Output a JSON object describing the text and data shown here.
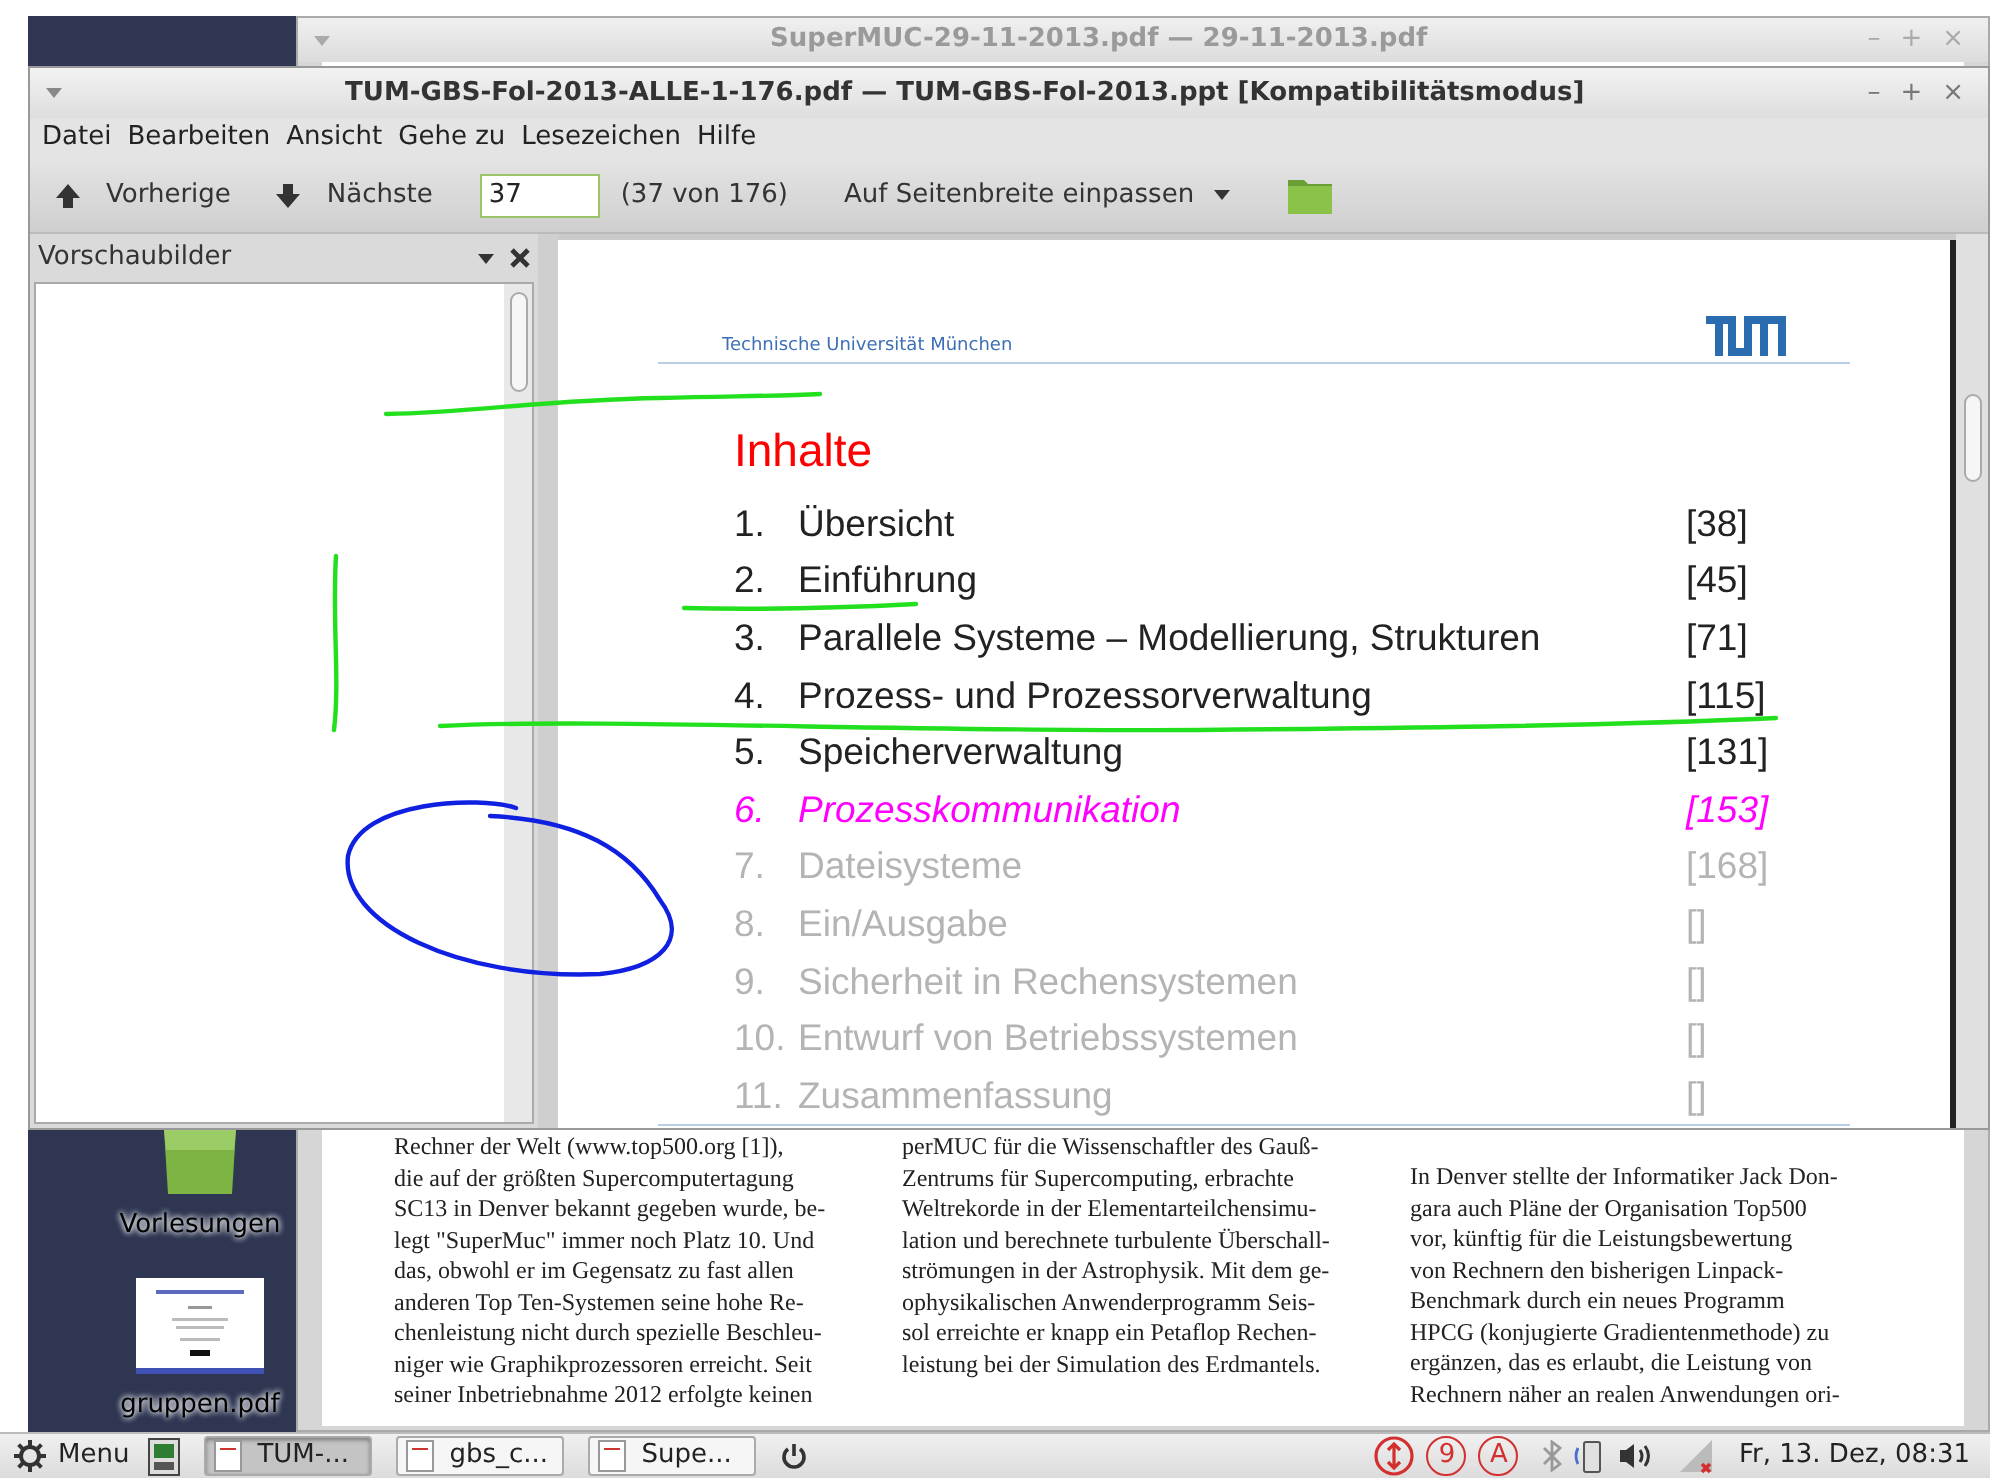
{
  "desktop": {
    "icons": [
      {
        "label": "Vorlesungen",
        "kind": "folder"
      },
      {
        "label": "gruppen.pdf",
        "kind": "document"
      }
    ]
  },
  "back_window": {
    "title": "SuperMUC-29-11-2013.pdf — 29-11-2013.pdf",
    "window_buttons": [
      "–",
      "+",
      "×"
    ],
    "columns": [
      {
        "lines": [
          "Rechner der Welt (www.top500.org [1]),",
          "die auf der größten Supercomputertagung",
          "SC13 in Denver bekannt gegeben wurde, be-",
          "legt \"SuperMuc\" immer noch Platz 10. Und",
          "das, obwohl er im Gegensatz zu fast allen",
          "anderen Top Ten-Systemen seine hohe Re-",
          "chenleistung nicht durch spezielle Beschleu-",
          "niger wie Graphikprozessoren erreicht. Seit",
          "seiner Inbetriebnahme 2012 erfolgte keinen"
        ]
      },
      {
        "lines": [
          "perMUC für die Wissenschaftler des Gauß-",
          "Zentrums für Supercomputing, erbrachte",
          "Weltrekorde in der Elementarteilchensimu-",
          "lation und berechnete turbulente Überschall-",
          "strömungen in der Astrophysik. Mit dem ge-",
          "ophysikalischen Anwenderprogramm Seis-",
          "sol erreichte er knapp ein Petaflop Rechen-",
          "leistung bei der Simulation des Erdmantels."
        ]
      },
      {
        "lines": [
          "In Denver stellte der Informatiker Jack Don-",
          "gara auch Pläne der Organisation Top500",
          "vor, künftig für die Leistungsbewertung",
          "von Rechnern den bisherigen Linpack-",
          "Benchmark durch ein neues Programm",
          "HPCG (konjugierte Gradientenmethode) zu",
          "ergänzen, das es erlaubt, die Leistung von",
          "Rechnern näher an realen Anwendungen ori-"
        ]
      }
    ]
  },
  "front_window": {
    "title": "TUM-GBS-Fol-2013-ALLE-1-176.pdf — TUM-GBS-Fol-2013.ppt [Kompatibilitätsmodus]",
    "window_buttons": [
      "–",
      "+",
      "×"
    ],
    "menu": [
      "Datei",
      "Bearbeiten",
      "Ansicht",
      "Gehe zu",
      "Lesezeichen",
      "Hilfe"
    ],
    "toolbar": {
      "previous": "Vorherige",
      "next": "Nächste",
      "page": "37",
      "page_count": "(37 von 176)",
      "zoom": "Auf Seitenbreite einpassen"
    },
    "sidebar": {
      "title": "Vorschaubilder"
    },
    "slide": {
      "header": "Technische Universität München",
      "heading": "Inhalte",
      "items": [
        {
          "number": "1.",
          "title": "Übersicht",
          "page": "[38]",
          "kind": "done"
        },
        {
          "number": "2.",
          "title": "Einführung",
          "page": "[45]",
          "kind": "done"
        },
        {
          "number": "3.",
          "title": "Parallele Systeme – Modellierung, Strukturen",
          "page": "[71]",
          "kind": "done"
        },
        {
          "number": "4.",
          "title": "Prozess- und Prozessorverwaltung",
          "page": "[115]",
          "kind": "done"
        },
        {
          "number": "5.",
          "title": "Speicherverwaltung",
          "page": "[131]",
          "kind": "done"
        },
        {
          "number": "6.",
          "title": "Prozesskommunikation",
          "page": "[153]",
          "kind": "current"
        },
        {
          "number": "7.",
          "title": "Dateisysteme",
          "page": "[168]",
          "kind": "pending"
        },
        {
          "number": "8.",
          "title": "Ein/Ausgabe",
          "page": "[]",
          "kind": "pending"
        },
        {
          "number": "9.",
          "title": "Sicherheit in Rechensystemen",
          "page": "[]",
          "kind": "pending"
        },
        {
          "number": "10.",
          "title": "Entwurf von Betriebssystemen",
          "page": "[]",
          "kind": "pending"
        },
        {
          "number": "11.",
          "title": "Zusammenfassung",
          "page": "[]",
          "kind": "pending"
        }
      ]
    }
  },
  "taskbar": {
    "menu": "Menu",
    "tasks": [
      {
        "label": "TUM-...",
        "selected": true
      },
      {
        "label": "gbs_c...",
        "selected": false
      },
      {
        "label": "Supe...",
        "selected": false
      }
    ],
    "tray_badges": [
      "9",
      "A"
    ],
    "clock": "Fr, 13. Dez, 08:31"
  }
}
